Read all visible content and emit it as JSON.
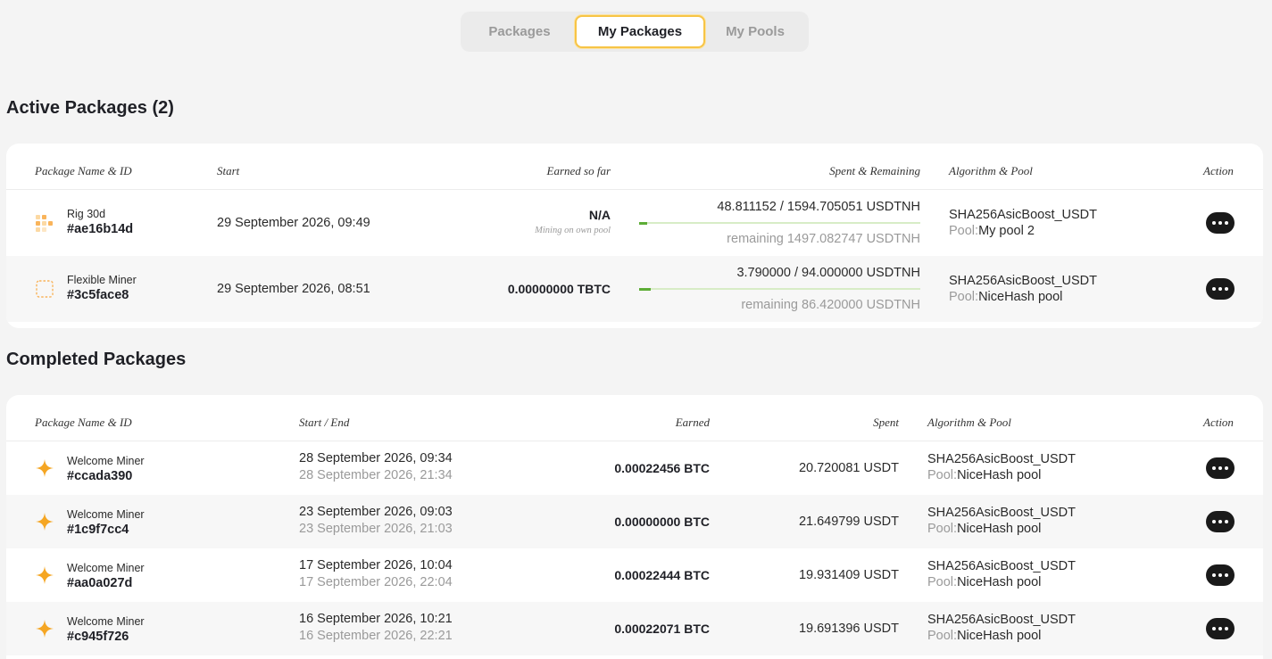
{
  "tabs": [
    {
      "label": "Packages",
      "active": false
    },
    {
      "label": "My Packages",
      "active": true
    },
    {
      "label": "My Pools",
      "active": false
    }
  ],
  "active_section": {
    "title": "Active Packages (2)",
    "headers": {
      "name": "Package Name & ID",
      "start": "Start",
      "earned": "Earned so far",
      "spent": "Spent & Remaining",
      "algo": "Algorithm & Pool",
      "action": "Action"
    },
    "rows": [
      {
        "name": "Rig 30d",
        "id": "#ae16b14d",
        "icon": "rig-grid-icon",
        "start": "29 September 2026, 09:49",
        "earned": "N/A",
        "earned_note": "Mining on own pool",
        "spent": "48.811152 / 1594.705051 USDTNH",
        "remaining": "remaining 1497.082747 USDTNH",
        "progress": 0.03,
        "algorithm": "SHA256AsicBoost_USDT",
        "pool_label": "Pool:",
        "pool": "My pool 2"
      },
      {
        "name": "Flexible Miner",
        "id": "#3c5face8",
        "icon": "dashed-square-icon",
        "start": "29 September 2026, 08:51",
        "earned": "0.00000000 TBTC",
        "earned_note": "",
        "spent": "3.790000 / 94.000000 USDTNH",
        "remaining": "remaining 86.420000 USDTNH",
        "progress": 0.04,
        "algorithm": "SHA256AsicBoost_USDT",
        "pool_label": "Pool:",
        "pool": "NiceHash pool"
      }
    ]
  },
  "completed_section": {
    "title": "Completed Packages",
    "headers": {
      "name": "Package Name & ID",
      "start_end": "Start / End",
      "earned": "Earned",
      "spent": "Spent",
      "algo": "Algorithm & Pool",
      "action": "Action"
    },
    "rows": [
      {
        "name": "Welcome Miner",
        "id": "#ccada390",
        "start": "28 September 2026, 09:34",
        "end": "28 September 2026, 21:34",
        "earned": "0.00022456 BTC",
        "spent": "20.720081 USDT",
        "algorithm": "SHA256AsicBoost_USDT",
        "pool_label": "Pool:",
        "pool": "NiceHash pool"
      },
      {
        "name": "Welcome Miner",
        "id": "#1c9f7cc4",
        "start": "23 September 2026, 09:03",
        "end": "23 September 2026, 21:03",
        "earned": "0.00000000 BTC",
        "spent": "21.649799 USDT",
        "algorithm": "SHA256AsicBoost_USDT",
        "pool_label": "Pool:",
        "pool": "NiceHash pool"
      },
      {
        "name": "Welcome Miner",
        "id": "#aa0a027d",
        "start": "17 September 2026, 10:04",
        "end": "17 September 2026, 22:04",
        "earned": "0.00022444 BTC",
        "spent": "19.931409 USDT",
        "algorithm": "SHA256AsicBoost_USDT",
        "pool_label": "Pool:",
        "pool": "NiceHash pool"
      },
      {
        "name": "Welcome Miner",
        "id": "#c945f726",
        "start": "16 September 2026, 10:21",
        "end": "16 September 2026, 22:21",
        "earned": "0.00022071 BTC",
        "spent": "19.691396 USDT",
        "algorithm": "SHA256AsicBoost_USDT",
        "pool_label": "Pool:",
        "pool": "NiceHash pool"
      }
    ]
  },
  "colors": {
    "accent": "#f7c446",
    "progress": "#5dad36",
    "star": "#f5a623"
  }
}
